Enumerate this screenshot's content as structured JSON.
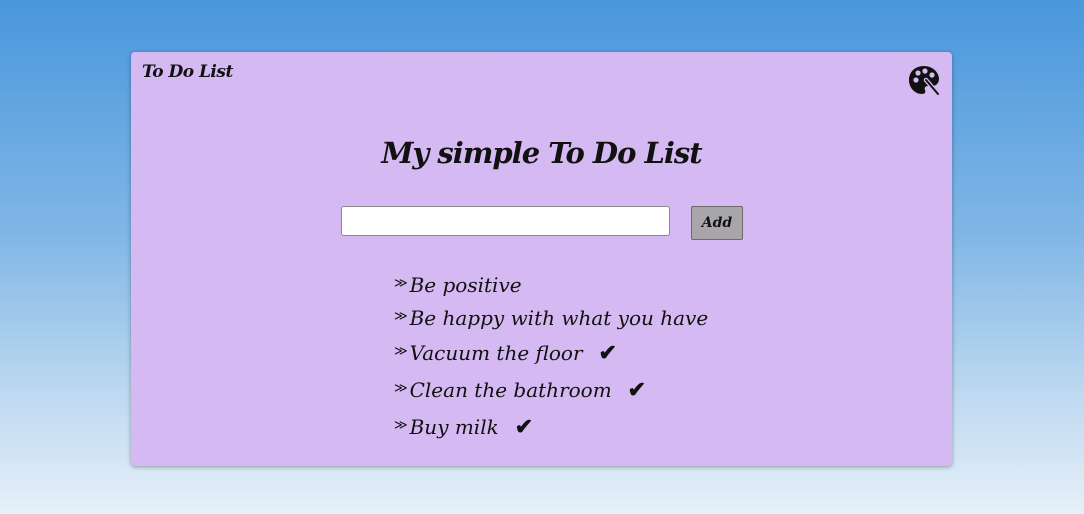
{
  "app": {
    "brand": "To Do List",
    "palette_icon": "palette-icon"
  },
  "main": {
    "title": "My simple To Do List",
    "input": {
      "value": "",
      "placeholder": ""
    },
    "add_label": "Add"
  },
  "todos": [
    {
      "prefix": "≫",
      "text": "Be positive",
      "done": false
    },
    {
      "prefix": "≫",
      "text": "Be happy with what you have",
      "done": false
    },
    {
      "prefix": "≫",
      "text": "Vacuum the floor",
      "done": true,
      "check": "✔"
    },
    {
      "prefix": "≫",
      "text": "Clean the bathroom",
      "done": true,
      "check": "✔"
    },
    {
      "prefix": "≫",
      "text": "Buy milk",
      "done": true,
      "check": "✔"
    }
  ],
  "colors": {
    "background_top": "#4a97dc",
    "background_bottom": "#e6f0f9",
    "card": "#d5b9f2",
    "button": "#a9a6ab"
  }
}
